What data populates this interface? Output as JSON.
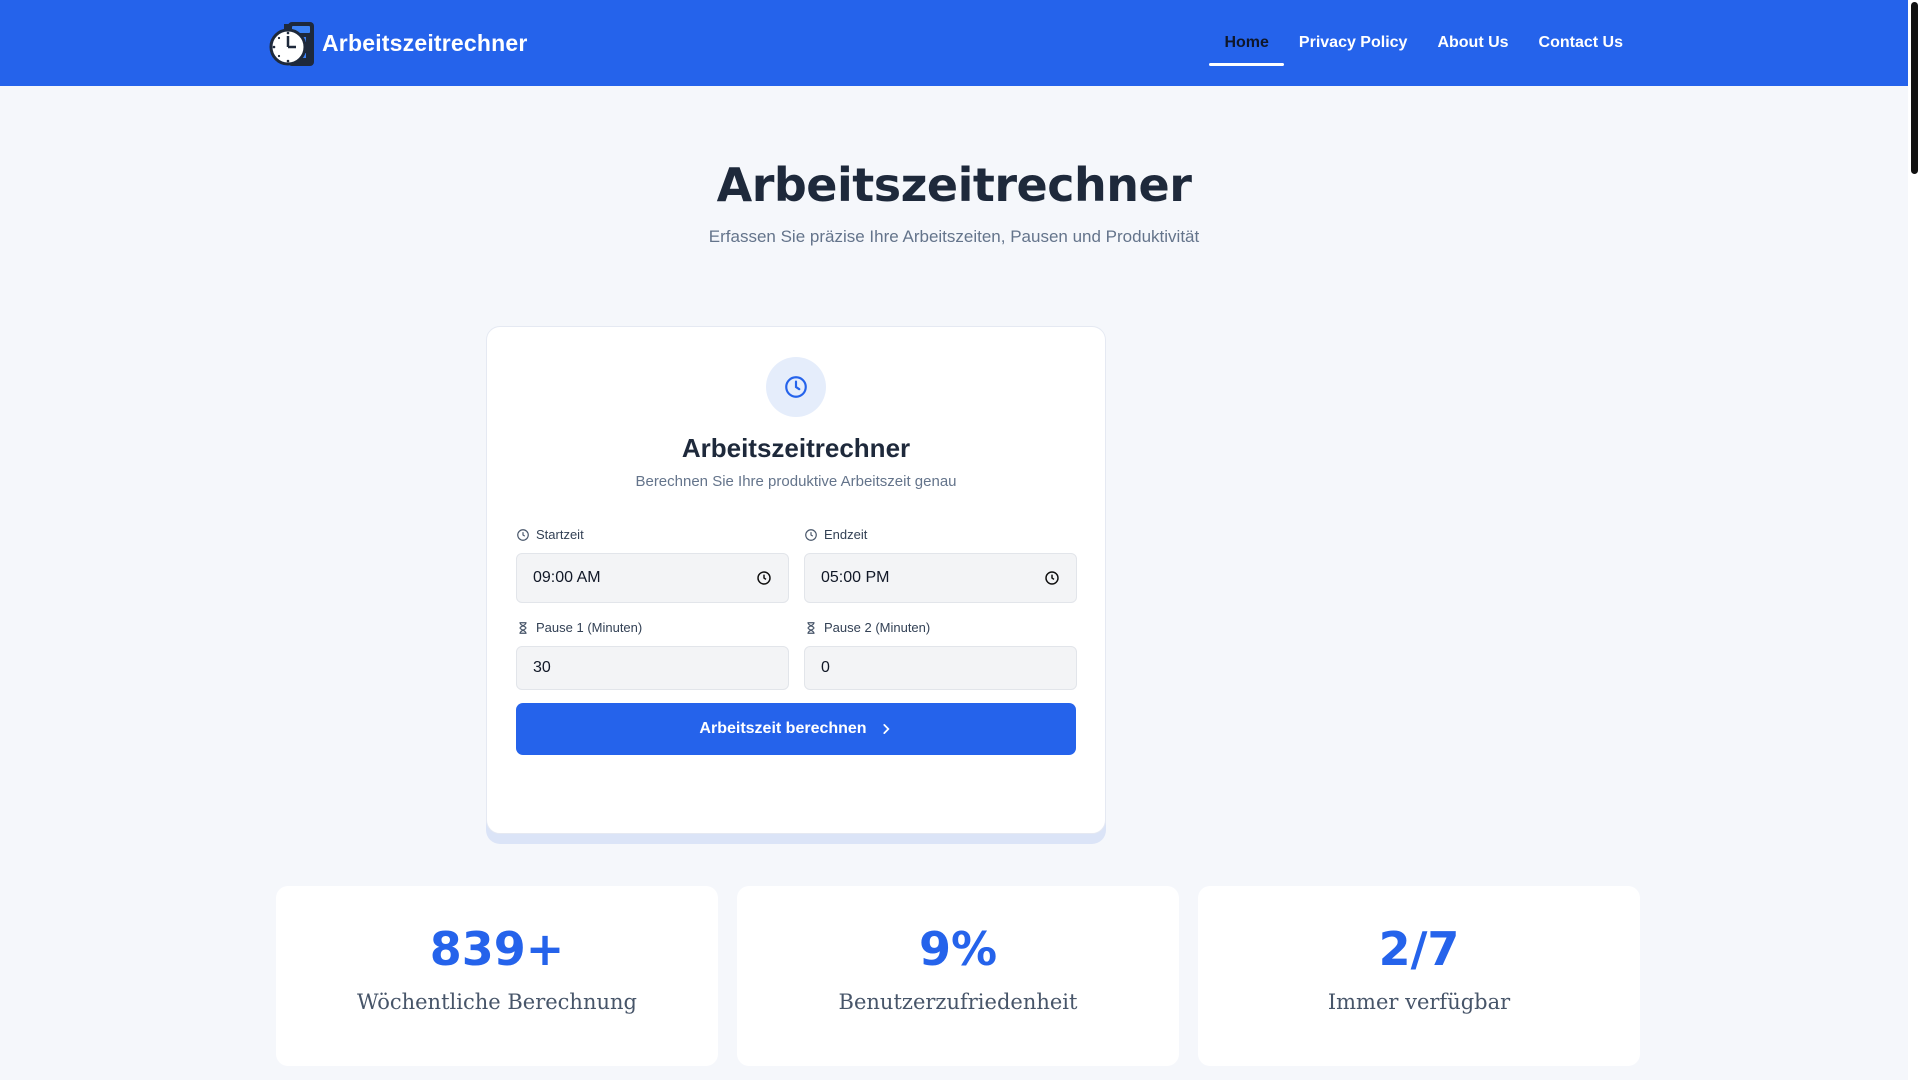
{
  "header": {
    "brand": "Arbeitszeitrechner",
    "nav": [
      {
        "label": "Home",
        "active": true
      },
      {
        "label": "Privacy Policy",
        "active": false
      },
      {
        "label": "About Us",
        "active": false
      },
      {
        "label": "Contact Us",
        "active": false
      }
    ],
    "bg_color": "#2563eb"
  },
  "hero": {
    "title": "Arbeitszeitrechner",
    "subtitle": "Erfassen Sie präzise Ihre Arbeitszeiten, Pausen und Produktivität"
  },
  "calculator": {
    "icon": "clock-icon",
    "title": "Arbeitszeitrechner",
    "subtitle": "Berechnen Sie Ihre produktive Arbeitszeit genau",
    "start": {
      "label": "Startzeit",
      "value": "09:00 AM",
      "icon": "clock-icon"
    },
    "end": {
      "label": "Endzeit",
      "value": "05:00 PM",
      "icon": "clock-icon"
    },
    "pause1": {
      "label": "Pause 1 (Minuten)",
      "value": "30",
      "icon": "hourglass-icon"
    },
    "pause2": {
      "label": "Pause 2 (Minuten)",
      "value": "0",
      "icon": "hourglass-icon"
    },
    "button_label": "Arbeitszeit berechnen",
    "accent": "#2563eb"
  },
  "stats": [
    {
      "value": "839+",
      "label": "Wöchentliche Berechnung"
    },
    {
      "value": "9%",
      "label": "Benutzerzufriedenheit"
    },
    {
      "value": "2/7",
      "label": "Immer verfügbar"
    }
  ]
}
